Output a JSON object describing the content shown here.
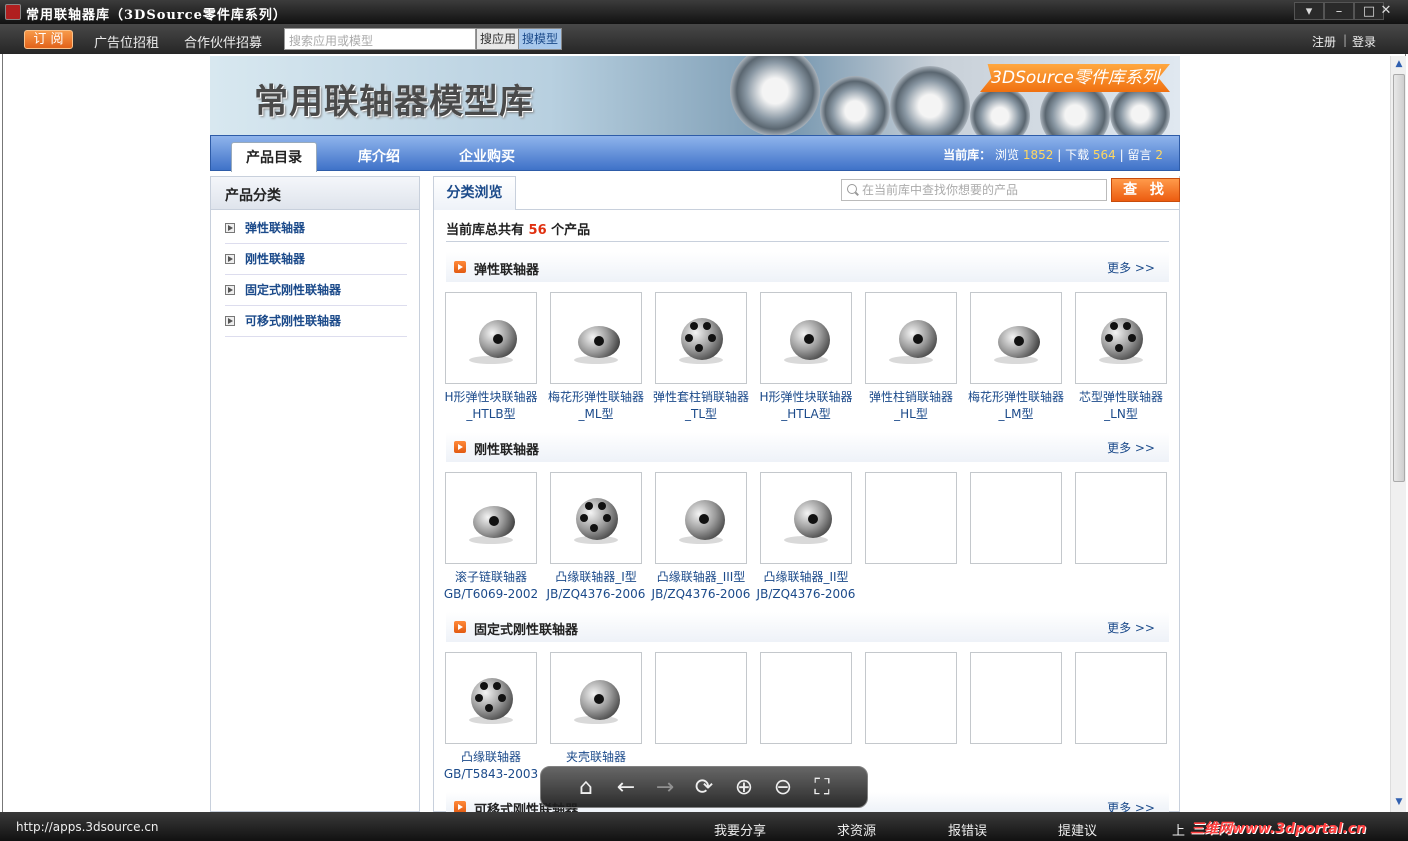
{
  "window": {
    "title": "常用联轴器库（3DSource零件库系列）",
    "controls": [
      "▾",
      "–",
      "□",
      "✕"
    ]
  },
  "toolbar": {
    "subscribe": "订 阅",
    "links": [
      "广告位招租",
      "合作伙伴招募"
    ],
    "search_placeholder": "搜索应用或模型",
    "search_app": "搜应用",
    "search_model": "搜模型",
    "register": "注册",
    "separator": "|",
    "login": "登录"
  },
  "banner": {
    "title": "常用联轴器模型库",
    "badge": "3DSource零件库系列"
  },
  "nav": {
    "tabs": [
      "产品目录",
      "库介绍",
      "企业购买"
    ],
    "stats_label": "当前库：",
    "views_label": "浏览",
    "views": "1852",
    "downloads_label": "下载",
    "downloads": "564",
    "comments_label": "留言",
    "comments": "2",
    "separator": "|"
  },
  "sidebar": {
    "title": "产品分类",
    "items": [
      "弹性联轴器",
      "刚性联轴器",
      "固定式刚性联轴器",
      "可移式刚性联轴器"
    ]
  },
  "main": {
    "tab": "分类浏览",
    "search_placeholder": "在当前库中查找你想要的产品",
    "find_button": "查 找",
    "total_prefix": "当前库总共有",
    "total_count": "56",
    "total_suffix": "个产品",
    "more": "更多 >>",
    "sections": [
      {
        "title": "弹性联轴器",
        "items": [
          {
            "line1": "H形弹性块联轴器",
            "line2": "_HTLB型"
          },
          {
            "line1": "梅花形弹性联轴器",
            "line2": "_ML型"
          },
          {
            "line1": "弹性套柱销联轴器",
            "line2": "_TL型"
          },
          {
            "line1": "H形弹性块联轴器",
            "line2": "_HTLA型"
          },
          {
            "line1": "弹性柱销联轴器",
            "line2": "_HL型"
          },
          {
            "line1": "梅花形弹性联轴器",
            "line2": "_LM型"
          },
          {
            "line1": "芯型弹性联轴器",
            "line2": "_LN型"
          }
        ]
      },
      {
        "title": "刚性联轴器",
        "items": [
          {
            "line1": "滚子链联轴器",
            "line2": "GB/T6069-2002"
          },
          {
            "line1": "凸缘联轴器_I型",
            "line2": "JB/ZQ4376-2006"
          },
          {
            "line1": "凸缘联轴器_III型",
            "line2": "JB/ZQ4376-2006"
          },
          {
            "line1": "凸缘联轴器_II型",
            "line2": "JB/ZQ4376-2006"
          }
        ]
      },
      {
        "title": "固定式刚性联轴器",
        "items": [
          {
            "line1": "凸缘联轴器",
            "line2": "GB/T5843-2003"
          },
          {
            "line1": "夹壳联轴器",
            "line2": ""
          }
        ]
      },
      {
        "title": "可移式刚性联轴器",
        "items": []
      }
    ]
  },
  "floatbar": {
    "icons": [
      "home-icon",
      "back-icon",
      "forward-icon",
      "refresh-icon",
      "zoom-in-icon",
      "zoom-out-icon",
      "fullscreen-icon"
    ]
  },
  "status": {
    "url": "http://apps.3dsource.cn",
    "links": [
      "我要分享",
      "求资源",
      "报错误",
      "提建议",
      "上"
    ],
    "watermark": "三维网www.3dportal.cn"
  },
  "colors": {
    "accent": "#ec5c10",
    "nav": "#3f72c8",
    "link": "#1b4a8a",
    "highlight": "#ffd860"
  }
}
